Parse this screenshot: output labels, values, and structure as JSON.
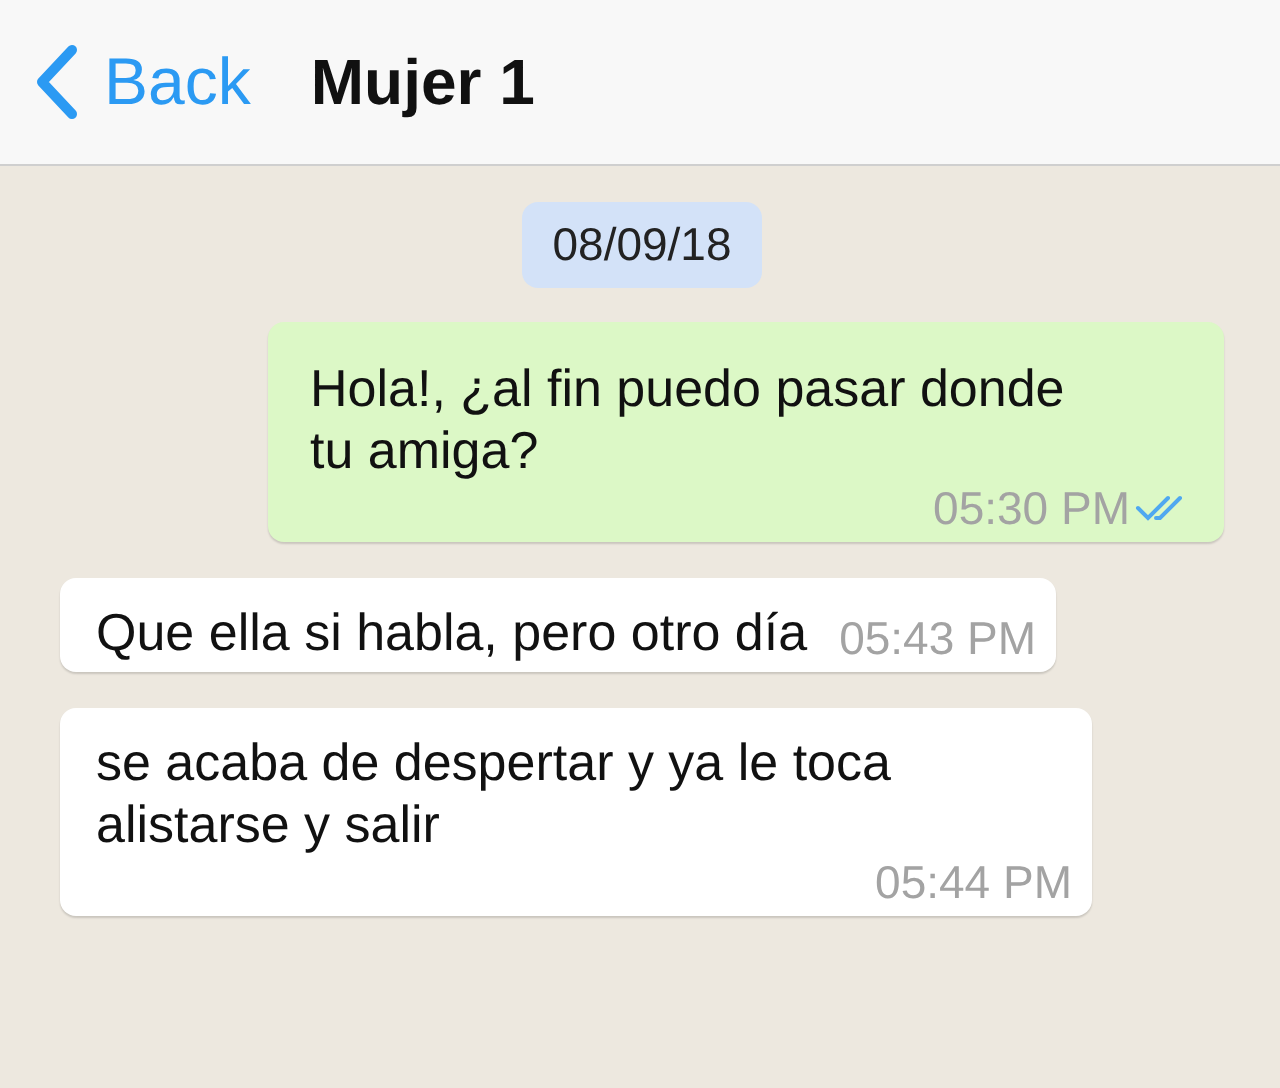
{
  "header": {
    "back_label": "Back",
    "title": "Mujer 1"
  },
  "date": "08/09/18",
  "messages": [
    {
      "kind": "out",
      "text": "Hola!, ¿al fin puedo pasar donde tu amiga?",
      "time": "05:30 PM",
      "read": true
    },
    {
      "kind": "in",
      "text": "Que ella si habla, pero otro día",
      "time": "05:43 PM"
    },
    {
      "kind": "in",
      "text": "se acaba de despertar y ya le toca alistarse y salir",
      "time": "05:44 PM"
    }
  ]
}
